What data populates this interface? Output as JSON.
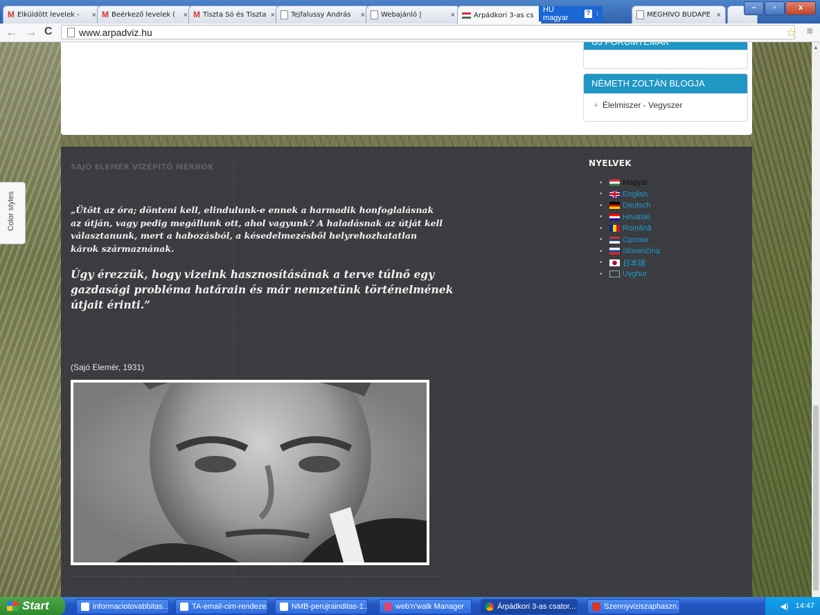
{
  "browser": {
    "tabs": [
      {
        "title": "Elküldött levelek -",
        "icon": "gmail-icon",
        "active": false
      },
      {
        "title": "Beérkező levelek (",
        "icon": "gmail-icon",
        "active": false
      },
      {
        "title": "Tiszta Só és Tiszta",
        "icon": "gmail-icon",
        "active": false
      },
      {
        "title": "Tejfalussy András",
        "icon": "document-icon",
        "active": false
      },
      {
        "title": "Webajánló |",
        "icon": "document-icon",
        "active": false
      },
      {
        "title": "Árpádkori 3-as cs",
        "icon": "flag-icon",
        "active": true
      },
      {
        "title": "MEGHÍVÓ BUDAPE",
        "icon": "document-icon",
        "active": false
      }
    ],
    "extension_label": "HU magyar",
    "extension_badge": "?",
    "url": "www.arpadviz.hu",
    "close_glyph": "×"
  },
  "page": {
    "sidebar": {
      "widget1_title": "ÚJ FÓRUMTÉMÁK",
      "widget2_title": "NÉMETH ZOLTÁN BLOGJA",
      "widget2_item": "Élelmiszer - Vegyszer"
    },
    "footer": {
      "section_title": "SAJÓ ELEMÉR VÍZÉPÍTŐ MÉRNÖK",
      "quote_part1": "„Ütött az óra; dönteni kell, elindulunk-e ennek a harmadik honfoglalásnak az útján, vagy pedig megállunk ott, ahol vagyunk? A haladásnak az útját kell választanunk, mert a habozásból, a késedelmezésből helyrehozhatatlan károk származnának.",
      "quote_part2": "Úgy érezzük, hogy vizeink hasznosításának a terve túlnő egy gazdasági probléma határain és már nemzetünk történelmének útjait érinti.”",
      "attribution": "(Sajó Elemér, 1931)"
    },
    "languages": {
      "title": "NYELVEK",
      "items": [
        {
          "label": "Magyar",
          "flag": "hungary-flag",
          "current": true
        },
        {
          "label": "English",
          "flag": "uk-flag",
          "current": false
        },
        {
          "label": "Deutsch",
          "flag": "germany-flag",
          "current": false
        },
        {
          "label": "Hrvatski",
          "flag": "croatia-flag",
          "current": false
        },
        {
          "label": "Română",
          "flag": "romania-flag",
          "current": false
        },
        {
          "label": "Српски",
          "flag": "serbia-flag",
          "current": false
        },
        {
          "label": "Slovenčina",
          "flag": "slovakia-flag",
          "current": false
        },
        {
          "label": "日本語",
          "flag": "japan-flag",
          "current": false
        },
        {
          "label": "Uyghur",
          "flag": "blank-flag",
          "current": false
        }
      ]
    },
    "color_styles_label": "Color styles"
  },
  "taskbar": {
    "start_label": "Start",
    "items": [
      {
        "label": "informaciotovabbitas...",
        "active": false
      },
      {
        "label": "TA-email-cim-rendeze...",
        "active": false
      },
      {
        "label": "NMB-perujrainditas-1...",
        "active": false
      },
      {
        "label": "web'n'walk Manager",
        "active": false
      },
      {
        "label": "Árpádkori 3-as csator...",
        "active": true
      },
      {
        "label": "Szennyviziszaphaszn...",
        "active": false
      }
    ],
    "clock": "14:47"
  },
  "colors": {
    "accent": "#1f96c4",
    "link": "#1d9ad4",
    "footer_bg": "#3a3c3f"
  }
}
